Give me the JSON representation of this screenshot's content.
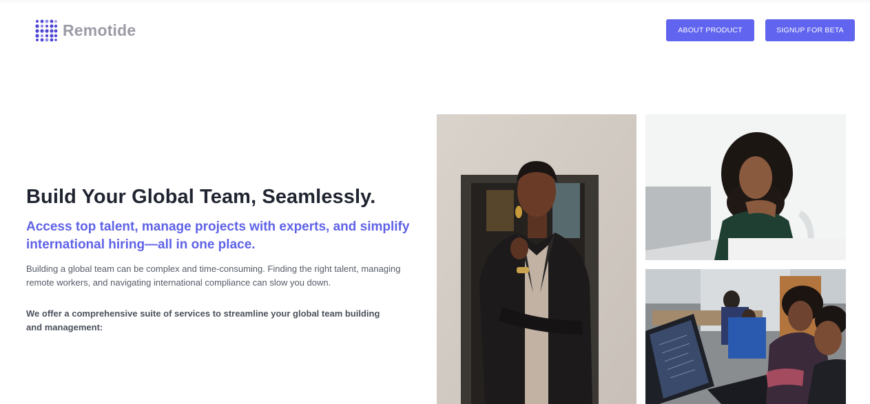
{
  "brand": {
    "name": "Remotide",
    "accent_color": "#6064ee"
  },
  "nav": {
    "about_label": "ABOUT PRODUCT",
    "signup_label": "SIGNUP FOR BETA"
  },
  "hero": {
    "headline": "Build Your Global Team, Seamlessly.",
    "subheadline": "Access top talent, manage projects with experts, and simplify international hiring—all in one place.",
    "body": "Building a global team can be complex and time-consuming. Finding the right talent, managing remote workers, and navigating international compliance can slow you down.",
    "body_bold": "We offer a comprehensive suite of services to streamline your global team building and management:"
  },
  "gallery": {
    "images": [
      {
        "icon": "woman-in-black-blazer-photo"
      },
      {
        "icon": "woman-at-laptop-photo"
      },
      {
        "icon": "team-at-computers-photo"
      }
    ]
  }
}
